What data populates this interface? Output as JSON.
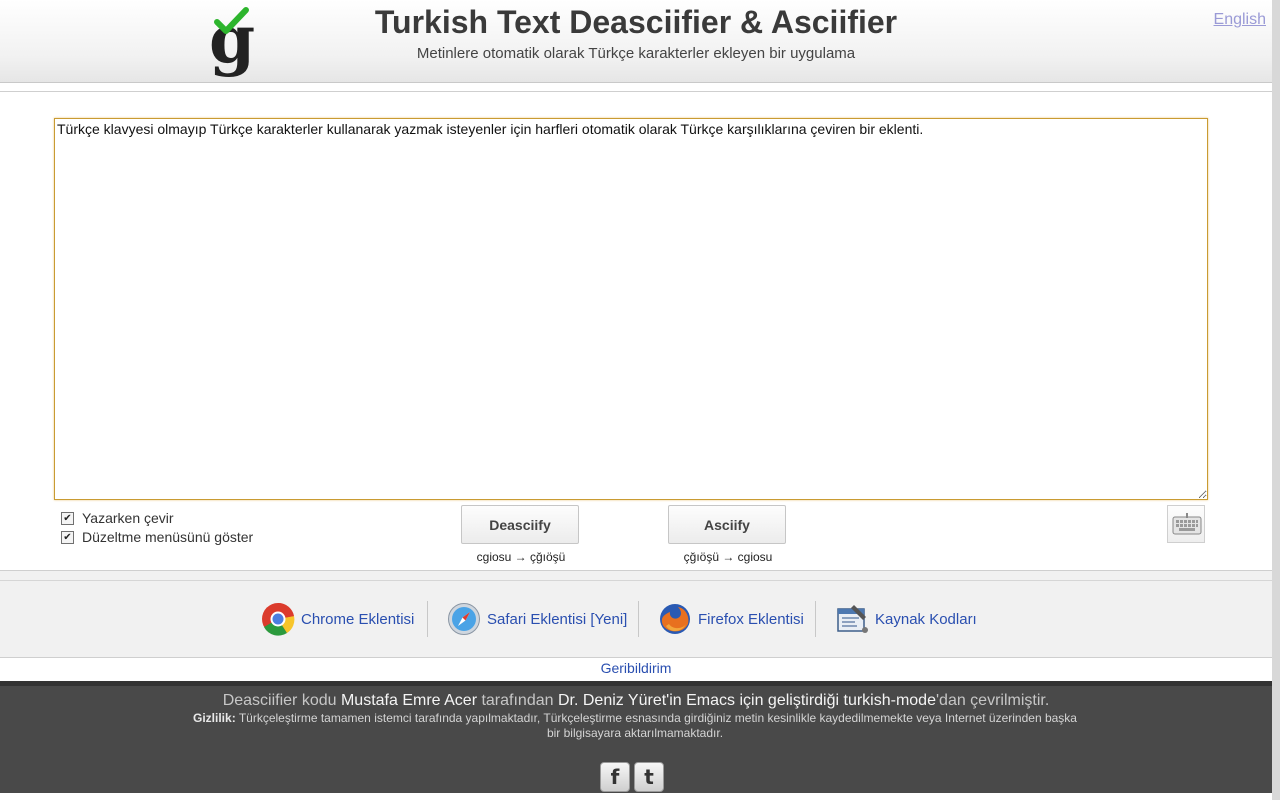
{
  "header": {
    "title": "Turkish Text Deasciifier & Asciifier",
    "subtitle": "Metinlere otomatik olarak Türkçe karakterler ekleyen bir uygulama",
    "language_link": "English",
    "logo_letter": "g"
  },
  "editor": {
    "text": "Türkçe klavyesi olmayıp Türkçe karakterler kullanarak yazmak isteyenler için harfleri otomatik olarak Türkçe karşılıklarına çeviren bir eklenti."
  },
  "options": {
    "convert_while_typing": {
      "label": "Yazarken çevir",
      "checked": true
    },
    "show_correction_menu": {
      "label": "Düzeltme menüsünü göster",
      "checked": true
    }
  },
  "actions": {
    "deasciify": {
      "label": "Deasciify",
      "hint": "cgiosu → çğıöşü"
    },
    "asciify": {
      "label": "Asciify",
      "hint": "çğıöşü → cgiosu"
    },
    "keyboard_icon": "keyboard-icon"
  },
  "extensions": [
    {
      "label": "Chrome Eklentisi",
      "icon": "chrome-icon"
    },
    {
      "label": "Safari Eklentisi [Yeni]",
      "icon": "safari-icon"
    },
    {
      "label": "Firefox Eklentisi",
      "icon": "firefox-icon"
    },
    {
      "label": "Kaynak Kodları",
      "icon": "source-code-icon"
    }
  ],
  "feedback": "Geribildirim",
  "footer": {
    "credits": {
      "p1": "Deasciifier kodu ",
      "author": "Mustafa Emre Acer",
      "p2": " tarafından ",
      "original_author": "Dr. Deniz Yüret'in Emacs için geliştirdiği turkish-mode",
      "p3": "'dan çevrilmiştir."
    },
    "privacy_label": "Gizlilik:",
    "privacy_text": " Türkçeleştirme tamamen istemci tarafında yapılmaktadır, Türkçeleştirme esnasında girdiğiniz metin kesinlikle kaydedilmemekte veya Internet üzerinden başka bir bilgisayara aktarılmamaktadır.",
    "social": {
      "facebook": "f",
      "twitter": "t"
    }
  },
  "colors": {
    "link": "#2a4fb0",
    "footer_bg": "#494949",
    "textarea_border": "#c99b32",
    "check_green": "#2db52d"
  }
}
